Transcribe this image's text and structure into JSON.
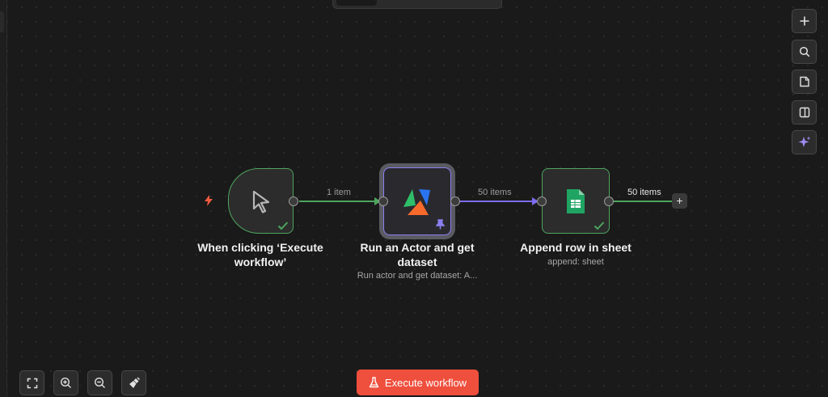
{
  "canvas": {
    "edges": [
      {
        "label": "1 item",
        "color": "#4ea55f"
      },
      {
        "label": "50 items",
        "color": "#7c6cf0"
      },
      {
        "label": "50 items",
        "color": "#4ea55f"
      }
    ]
  },
  "nodes": [
    {
      "title": "When clicking ‘Execute workflow’",
      "subtitle": "",
      "icon": "cursor-icon",
      "status": "success"
    },
    {
      "title": "Run an Actor and get dataset",
      "subtitle": "Run actor and get dataset: A...",
      "icon": "apify-logo",
      "status": "pinned"
    },
    {
      "title": "Append row in sheet",
      "subtitle": "append: sheet",
      "icon": "google-sheets-icon",
      "status": "success"
    }
  ],
  "right_toolbar": [
    {
      "name": "add-node-button",
      "icon": "plus-icon"
    },
    {
      "name": "search-button",
      "icon": "search-icon"
    },
    {
      "name": "sticky-note-button",
      "icon": "note-icon"
    },
    {
      "name": "toggle-panel-button",
      "icon": "panel-icon"
    },
    {
      "name": "ai-assistant-button",
      "icon": "sparkle-icon"
    }
  ],
  "bottom_toolbar": [
    {
      "name": "fit-view-button",
      "icon": "fit-view-icon"
    },
    {
      "name": "zoom-in-button",
      "icon": "zoom-in-icon"
    },
    {
      "name": "zoom-out-button",
      "icon": "zoom-out-icon"
    },
    {
      "name": "tidy-up-button",
      "icon": "broom-icon"
    }
  ],
  "execute_button": {
    "label": "Execute workflow",
    "icon": "flask-icon",
    "color": "#ef4f3d"
  },
  "colors": {
    "success": "#4ea55f",
    "selected": "#8b7ff0",
    "background": "#1a1a1a"
  }
}
